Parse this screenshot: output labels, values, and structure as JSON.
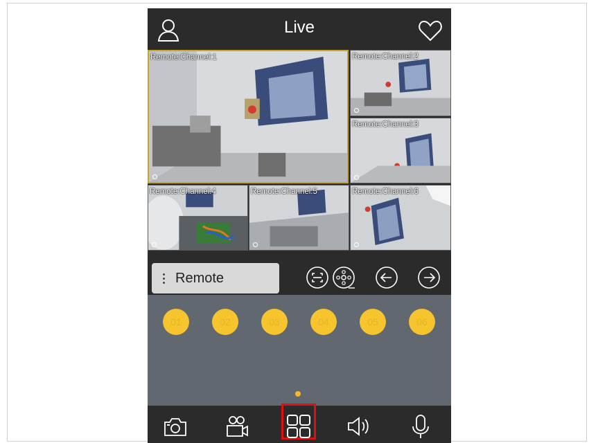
{
  "header": {
    "title": "Live"
  },
  "cameras": [
    {
      "label": "Remote:Channel:1"
    },
    {
      "label": "Remote:Channel:2"
    },
    {
      "label": "Remote:Channel:3"
    },
    {
      "label": "Remote:Channel:4"
    },
    {
      "label": "Remote:Channel:5"
    },
    {
      "label": "Remote:Channel:6"
    }
  ],
  "toolbar": {
    "device_name": "Remote"
  },
  "channels": [
    "01",
    "02",
    "03",
    "04",
    "05",
    "06"
  ],
  "colors": {
    "accent": "#f6c52d",
    "selected_border": "#c9a527",
    "highlight": "#e01010",
    "panel_bg": "#626870",
    "bar_bg": "#2b2b2b"
  },
  "icons": {
    "header": [
      "user-icon",
      "heart-icon"
    ],
    "toolbar": [
      "screenshot-icon",
      "ptz-icon",
      "arrow-left-icon",
      "arrow-right-icon"
    ],
    "bottom": [
      "camera-icon",
      "video-record-icon",
      "layout-grid-icon",
      "speaker-icon",
      "microphone-icon"
    ]
  }
}
